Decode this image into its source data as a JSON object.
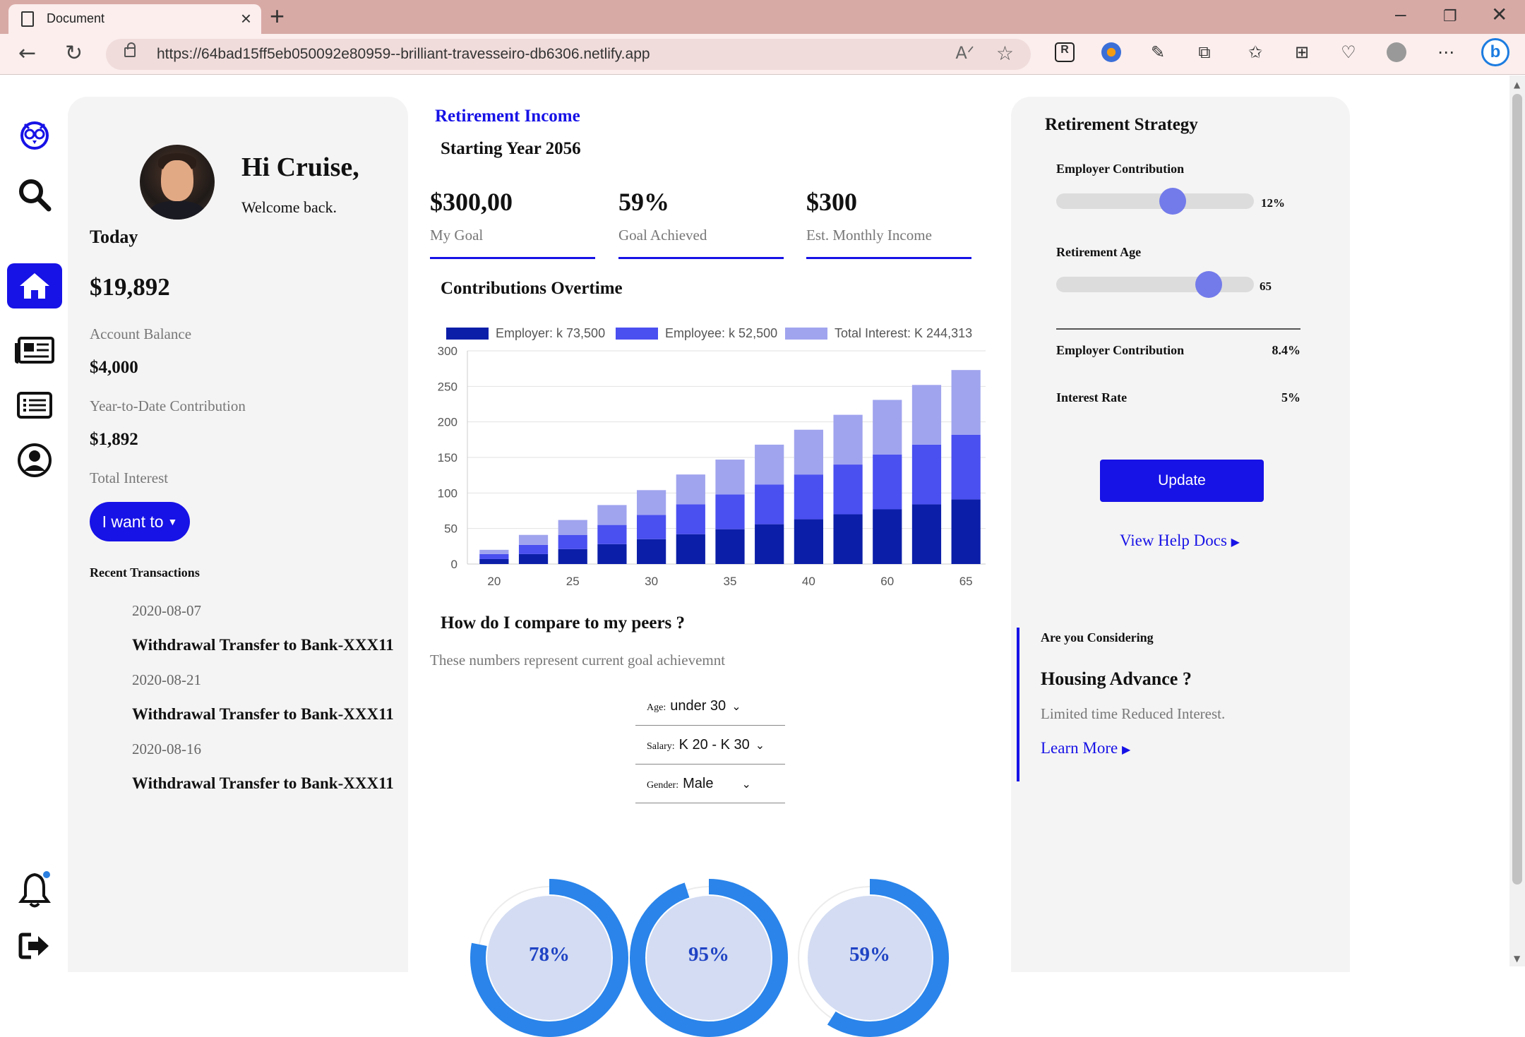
{
  "browser": {
    "tab_title": "Document",
    "url": "https://64bad15ff5eb050092e80959--brilliant-travesseiro-db6306.netlify.app"
  },
  "profile": {
    "greeting": "Hi Cruise,",
    "welcome": "Welcome back."
  },
  "account": {
    "today_label": "Today",
    "balance": "$19,892",
    "balance_label": "Account Balance",
    "ytd": "$4,000",
    "ytd_label": "Year-to-Date Contribution",
    "interest": "$1,892",
    "interest_label": "Total Interest",
    "action_label": "I want to"
  },
  "transactions": {
    "title": "Recent Transactions",
    "items": [
      {
        "date": "2020-08-07",
        "desc": "Withdrawal Transfer to Bank-XXX11"
      },
      {
        "date": "2020-08-21",
        "desc": "Withdrawal Transfer to Bank-XXX11"
      },
      {
        "date": "2020-08-16",
        "desc": "Withdrawal Transfer to Bank-XXX11"
      }
    ]
  },
  "income": {
    "title": "Retirement Income",
    "year": "Starting Year 2056",
    "stats": [
      {
        "value": "$300,00",
        "label": "My Goal"
      },
      {
        "value": "59%",
        "label": "Goal Achieved"
      },
      {
        "value": "$300",
        "label": "Est. Monthly Income"
      }
    ]
  },
  "contributions_title": "Contributions Overtime",
  "chart_data": {
    "type": "bar",
    "stacked": true,
    "categories": [
      "20",
      "",
      "25",
      "",
      "30",
      "",
      "35",
      "",
      "40",
      "",
      "60",
      "",
      "65"
    ],
    "series": [
      {
        "name": "Employer: k 73,500",
        "color": "#0b1ea8",
        "values": [
          7,
          14,
          21,
          28,
          35,
          42,
          49,
          56,
          63,
          70,
          77,
          84,
          91
        ]
      },
      {
        "name": "Employee: k 52,500",
        "color": "#4a4ff0",
        "values": [
          7,
          13,
          20,
          27,
          34,
          42,
          49,
          56,
          63,
          70,
          77,
          84,
          91
        ]
      },
      {
        "name": "Total Interest: K 244,313",
        "color": "#a0a4ee",
        "values": [
          6,
          14,
          21,
          28,
          35,
          42,
          49,
          56,
          63,
          70,
          77,
          84,
          91
        ]
      }
    ],
    "ylim": [
      0,
      300
    ],
    "yticks": [
      0,
      50,
      100,
      150,
      200,
      250,
      300
    ],
    "grid": true,
    "legend": "top"
  },
  "peers": {
    "title": "How do I compare to my peers ?",
    "subtitle": "These numbers represent current goal achievemnt",
    "filters": [
      {
        "label": "Age:",
        "value": "under 30"
      },
      {
        "label": "Salary:",
        "value": "K 20 - K 30"
      },
      {
        "label": "Gender:",
        "value": "Male"
      }
    ],
    "donuts": [
      {
        "percent": "78%",
        "fraction": 0.78
      },
      {
        "percent": "95%",
        "fraction": 0.95
      },
      {
        "percent": "59%",
        "fraction": 0.59
      }
    ]
  },
  "strategy": {
    "title": "Retirement Strategy",
    "employer_label": "Employer Contribution",
    "employer_value": "12%",
    "employer_fraction": 0.59,
    "age_label": "Retirement Age",
    "age_value": "65",
    "age_fraction": 0.77,
    "rows": [
      {
        "label": "Employer Contribution",
        "value": "8.4%"
      },
      {
        "label": "Interest Rate",
        "value": "5%"
      }
    ],
    "update_label": "Update",
    "help_label": "View Help Docs"
  },
  "promo": {
    "question": "Are you Considering",
    "title": "Housing Advance ?",
    "subtitle": "Limited time Reduced Interest.",
    "link": "Learn More"
  },
  "colors": {
    "accent": "#1712e6",
    "panel": "#f5f4f4",
    "donut_ring": "#2a84ea",
    "donut_fill": "#d3dcf2"
  }
}
